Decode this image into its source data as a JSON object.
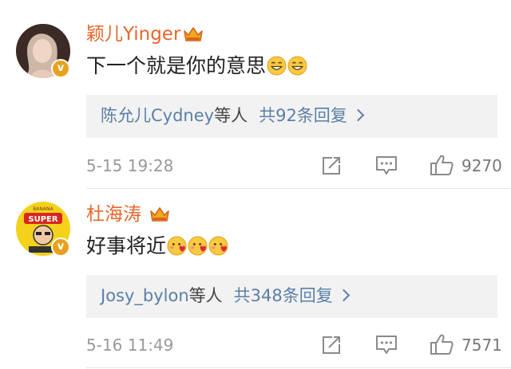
{
  "comments": [
    {
      "user": "颖儿Yinger",
      "text": "下一个就是你的意思",
      "emojis": [
        "grin-emoji",
        "grin-emoji"
      ],
      "replies_user": "陈允儿Cydney",
      "replies_others": "等人",
      "replies_count": "共92条回复",
      "time": "5-15 19:28",
      "likes": "9270",
      "verified": "v"
    },
    {
      "user": "杜海涛",
      "text": "好事将近",
      "emojis": [
        "heart-blush-emoji",
        "heart-blush-emoji",
        "heart-blush-emoji"
      ],
      "replies_user": "Josy_bylon",
      "replies_others": "等人",
      "replies_count": "共348条回复",
      "time": "5-16 11:49",
      "likes": "7571",
      "verified": "v"
    }
  ],
  "colors": {
    "name": "#e8672c",
    "link": "#5b7fa8",
    "badge": "#e8a220",
    "reply_bg": "#f2f2f2"
  }
}
